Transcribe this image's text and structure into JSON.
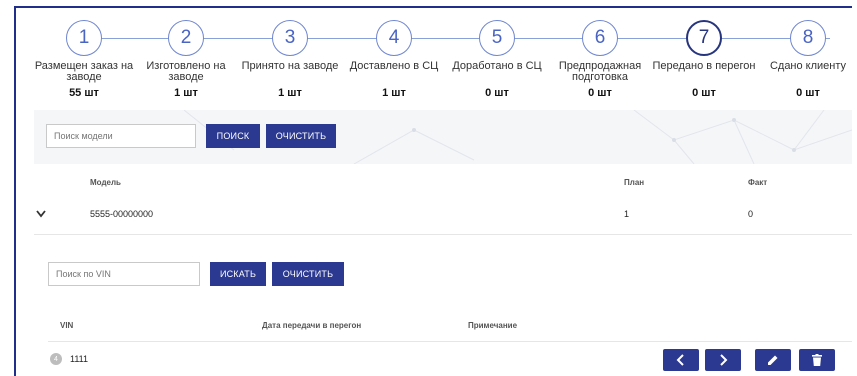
{
  "stepper": {
    "steps": [
      {
        "number": "1",
        "label": "Размещен заказ на заводе",
        "count": "55 шт"
      },
      {
        "number": "2",
        "label": "Изготовлено на заводе",
        "count": "1 шт"
      },
      {
        "number": "3",
        "label": "Принято на заводе",
        "count": "1 шт"
      },
      {
        "number": "4",
        "label": "Доставлено в СЦ",
        "count": "1 шт"
      },
      {
        "number": "5",
        "label": "Доработано в СЦ",
        "count": "0 шт"
      },
      {
        "number": "6",
        "label": "Предпродажная подготовка",
        "count": "0 шт"
      },
      {
        "number": "7",
        "label": "Передано в перегон",
        "count": "0 шт"
      },
      {
        "number": "8",
        "label": "Сдано клиенту",
        "count": "0 шт"
      }
    ],
    "active_step": 7
  },
  "model_search": {
    "placeholder": "Поиск модели",
    "search_label": "ПОИСК",
    "clear_label": "ОЧИСТИТЬ"
  },
  "models_table": {
    "headers": {
      "model": "Модель",
      "plan": "План",
      "fact": "Факт"
    },
    "rows": [
      {
        "model": "5555-00000000",
        "plan": "1",
        "fact": "0"
      }
    ]
  },
  "vin_search": {
    "placeholder": "Поиск по VIN",
    "search_label": "ИСКАТЬ",
    "clear_label": "ОЧИСТИТЬ"
  },
  "vin_table": {
    "headers": {
      "vin": "VIN",
      "date": "Дата передачи в перегон",
      "note": "Примечание"
    },
    "rows": [
      {
        "badge": "4",
        "vin": "1111"
      }
    ]
  },
  "colors": {
    "primary": "#2b3990",
    "active_step": "#27357e",
    "step_inactive": "#6f86d0"
  },
  "icons": [
    "chevron-down-icon",
    "chevron-left-icon",
    "chevron-right-icon",
    "pencil-icon",
    "trash-icon"
  ]
}
